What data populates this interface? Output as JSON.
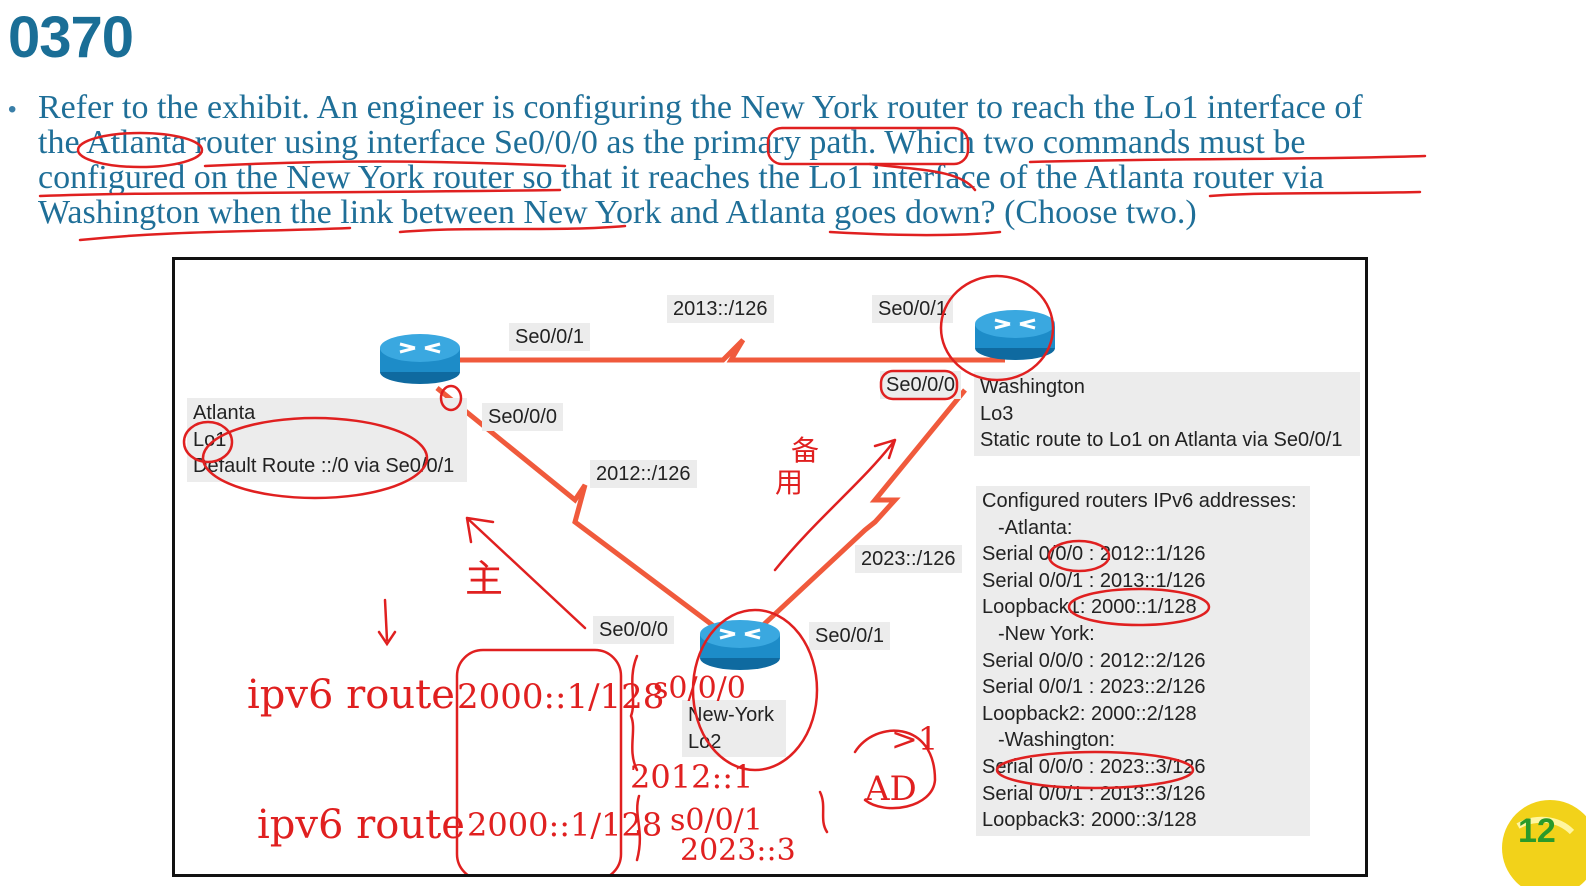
{
  "title": "0370",
  "question": {
    "lines": [
      "Refer to the exhibit. An engineer is configuring the New York router to reach the Lo1 interface of",
      "the Atlanta router using interface Se0/0/0 as the primary path. Which two commands must be",
      "configured on the New York router so that it reaches the Lo1 interface of the Atlanta router via",
      "Washington when the link between New York and Atlanta goes down? (Choose two.)"
    ]
  },
  "exhibit": {
    "links": {
      "atl_wash_net": "2013::/126",
      "atl_ny_net": "2012::/126",
      "ny_wash_net": "2023::/126"
    },
    "interfaces": {
      "atl_se001": "Se0/0/1",
      "atl_se000": "Se0/0/0",
      "wash_se001": "Se0/0/1",
      "wash_se000": "Se0/0/0",
      "ny_se000": "Se0/0/0",
      "ny_se001": "Se0/0/1"
    },
    "atlanta": {
      "name": "Atlanta",
      "loopback": "Lo1",
      "route": "Default Route ::/0 via Se0/0/1"
    },
    "washington": {
      "name": "Washington",
      "loopback": "Lo3",
      "route": "Static route to Lo1 on Atlanta via Se0/0/1"
    },
    "newyork": {
      "name": "New-York",
      "loopback": "Lo2"
    },
    "addresses": {
      "heading": "Configured routers IPv6 addresses:",
      "groups": [
        {
          "name": "-Atlanta:",
          "entries": [
            "Serial 0/0/0 : 2012::1/126",
            "Serial 0/0/1 : 2013::1/126",
            "Loopback1: 2000::1/128"
          ]
        },
        {
          "name": "-New York:",
          "entries": [
            "Serial 0/0/0 : 2012::2/126",
            "Serial 0/0/1 : 2023::2/126",
            "Loopback2: 2000::2/128"
          ]
        },
        {
          "name": "-Washington:",
          "entries": [
            "Serial 0/0/0 : 2023::3/126",
            "Serial 0/0/1 : 2013::3/126",
            "Loopback3: 2000::3/128"
          ]
        }
      ]
    }
  },
  "annotations": {
    "main": "主",
    "backup_1": "备",
    "backup_2": "用",
    "cmd1_prefix": "ipv6 route",
    "cmd1_dest": "2000::1/128",
    "cmd1_iface": "s0/0/0",
    "cmd1_hop": "2012::1",
    "cmd2_prefix": "ipv6 route",
    "cmd2_dest": "2000::1/128",
    "cmd2_iface": "s0/0/1",
    "cmd2_hop": "2023::3",
    "ad_label": "AD",
    "ad_value": ">1"
  },
  "colors": {
    "title": "#1a6e96",
    "question": "#1f6f98",
    "link": "#f05a3c",
    "ink": "#e02020",
    "router": "#1d8cc8"
  },
  "page_number": "12"
}
